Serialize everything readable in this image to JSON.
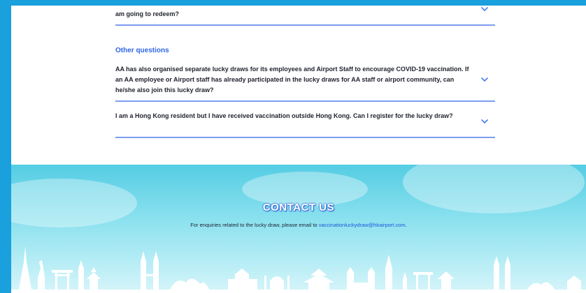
{
  "faq": {
    "top_partial_question": "am going to redeem?",
    "other_heading": "Other questions",
    "questions": [
      "AA has also organised separate lucky draws for its employees and Airport Staff to encourage COVID-19 vaccination. If an AA employee or Airport staff has already participated in the lucky draws for AA staff or airport community, can he/she also join this lucky draw?",
      "I am a Hong Kong resident but I have received vaccination outside Hong Kong. Can I register for the lucky draw?"
    ]
  },
  "contact": {
    "title": "CONTACT US",
    "text": "For enquiries related to the lucky draw, please email to ",
    "email": "vaccinationluckydraw@hkairport.com",
    "trailing": "."
  },
  "colors": {
    "accent": "#2f66e6",
    "divider": "#7d9df0",
    "frame": "#1aa0dc"
  }
}
